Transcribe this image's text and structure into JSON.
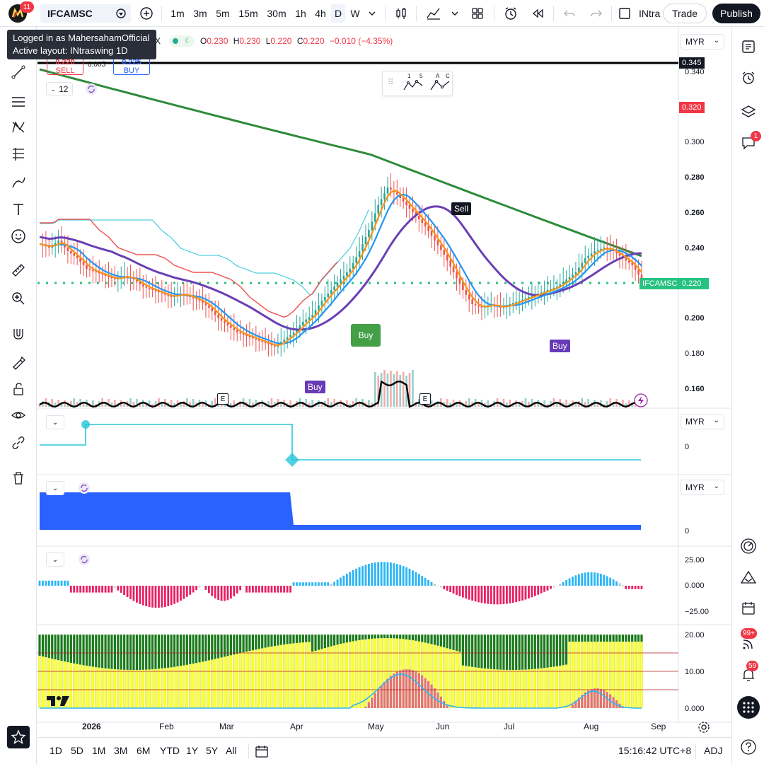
{
  "app": {
    "notification_count": "11",
    "symbol": "IFCAMSC",
    "timeframes": [
      "1m",
      "3m",
      "5m",
      "15m",
      "30m",
      "1h",
      "4h",
      "D",
      "W"
    ],
    "active_timeframe": "D",
    "layout_partial": "INtra",
    "trade_label": "Trade",
    "publish_label": "Publish"
  },
  "tooltip": {
    "line1": "Logged in as MahersahamOfficial",
    "line2": "Active layout: INtraswing 1D"
  },
  "legend": {
    "x_glyph": "X",
    "open_label": "O",
    "open": "0.230",
    "high_label": "H",
    "high": "0.230",
    "low_label": "L",
    "low": "0.220",
    "close_label": "C",
    "close": "0.220",
    "change": "−0.010 (−4.35%)",
    "sell_price": "0.220",
    "sell_label": "SELL",
    "spread": "0.005",
    "buy_price": "0.225",
    "buy_label": "BUY",
    "indicator_count": "12",
    "pattern_labels": [
      "1",
      "5",
      "A",
      "C"
    ]
  },
  "price_axis": {
    "currency": "MYR",
    "ticks": [
      "0.340",
      "0.300",
      "0.280",
      "0.260",
      "0.240",
      "0.200",
      "0.180",
      "0.160"
    ],
    "line_tag": "0.345",
    "alert_tag": "0.320",
    "last_price": "0.220",
    "last_symbol": "IFCAMSC"
  },
  "signals": {
    "sell": "Sell",
    "buy1": "Buy",
    "buy2": "Buy",
    "buy3": "Buy",
    "earnings": "E"
  },
  "panes": [
    {
      "currency": "MYR",
      "ticks": [
        "0"
      ]
    },
    {
      "currency": "MYR",
      "ticks": [
        "0"
      ]
    },
    {
      "ticks": [
        "25.00",
        "0.000",
        "−25.00"
      ]
    },
    {
      "ticks": [
        "20.00",
        "10.00",
        "0.000"
      ]
    }
  ],
  "time_axis": [
    "2026",
    "Feb",
    "Mar",
    "Apr",
    "May",
    "Jun",
    "Jul",
    "Aug",
    "Sep"
  ],
  "bottom": {
    "ranges": [
      "1D",
      "5D",
      "1M",
      "3M",
      "6M",
      "YTD",
      "1Y",
      "5Y",
      "All"
    ],
    "clock": "15:16:42 UTC+8",
    "adj": "ADJ"
  },
  "right_badges": {
    "chat": "1",
    "feed": "99+",
    "alerts": "59"
  },
  "colors": {
    "up": "#26a69a",
    "down": "#ef5350",
    "ma_green": "#2e8b3a",
    "ma_purple": "#6a3fb5",
    "ma_orange": "#f7931a",
    "ma_blue": "#2196f3",
    "cyan": "#26c6da",
    "magenta": "#e91e63",
    "yellow": "#ffff33",
    "dark_green": "#1b7a1b"
  },
  "chart_data": {
    "type": "candlestick",
    "symbol": "IFCAMSC",
    "timeframe": "D",
    "x_labels": [
      "2026",
      "Feb",
      "Mar",
      "Apr",
      "May",
      "Jun",
      "Jul",
      "Aug",
      "Sep"
    ],
    "ylim": [
      0.15,
      0.35
    ],
    "approx_close_by_period": {
      "Jan": [
        0.24,
        0.238,
        0.242,
        0.236,
        0.232,
        0.226,
        0.224,
        0.222,
        0.22
      ],
      "Feb": [
        0.222,
        0.22,
        0.216,
        0.214,
        0.212,
        0.21,
        0.212,
        0.21
      ],
      "Mar": [
        0.208,
        0.204,
        0.198,
        0.194,
        0.19,
        0.188,
        0.186,
        0.184
      ],
      "Apr": [
        0.182,
        0.186,
        0.19,
        0.196,
        0.2,
        0.208,
        0.214,
        0.22
      ],
      "May": [
        0.226,
        0.236,
        0.248,
        0.262,
        0.272,
        0.268,
        0.262,
        0.256
      ],
      "Jun": [
        0.25,
        0.242,
        0.234,
        0.224,
        0.214,
        0.206,
        0.204,
        0.206
      ],
      "Jul": [
        0.204,
        0.206,
        0.208,
        0.21,
        0.212,
        0.214,
        0.216,
        0.22
      ],
      "Aug": [
        0.224,
        0.232,
        0.236,
        0.238,
        0.236,
        0.232,
        0.228,
        0.22
      ]
    }
  }
}
